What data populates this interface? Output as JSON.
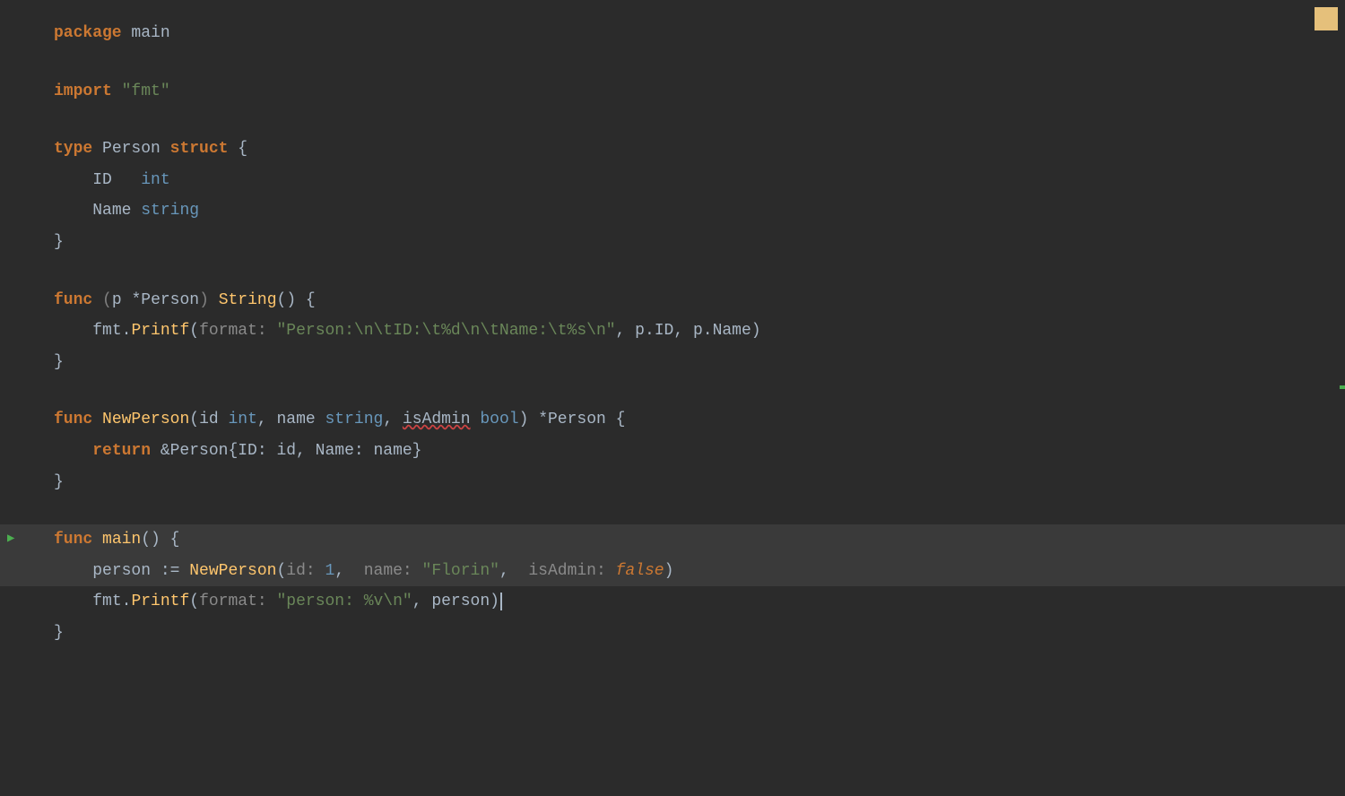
{
  "editor": {
    "background": "#2b2b2b",
    "lines": [
      {
        "id": 1,
        "type": "code",
        "content": "package main"
      },
      {
        "id": 2,
        "type": "empty"
      },
      {
        "id": 3,
        "type": "code",
        "content": "import \"fmt\""
      },
      {
        "id": 4,
        "type": "empty"
      },
      {
        "id": 5,
        "type": "code",
        "content": "type Person struct {"
      },
      {
        "id": 6,
        "type": "code",
        "content": "    ID   int"
      },
      {
        "id": 7,
        "type": "code",
        "content": "    Name string"
      },
      {
        "id": 8,
        "type": "code",
        "content": "}"
      },
      {
        "id": 9,
        "type": "empty"
      },
      {
        "id": 10,
        "type": "code",
        "content": "func (p *Person) String() {"
      },
      {
        "id": 11,
        "type": "code",
        "content": "    fmt.Printf(format: \"Person:\\n\\tID:\\t%d\\n\\tName:\\t%s\\n\", p.ID, p.Name)"
      },
      {
        "id": 12,
        "type": "code",
        "content": "}"
      },
      {
        "id": 13,
        "type": "empty"
      },
      {
        "id": 14,
        "type": "code",
        "content": "func NewPerson(id int, name string, isAdmin bool) *Person {"
      },
      {
        "id": 15,
        "type": "code",
        "content": "    return &Person{ID: id, Name: name}"
      },
      {
        "id": 16,
        "type": "code",
        "content": "}"
      },
      {
        "id": 17,
        "type": "empty"
      },
      {
        "id": 18,
        "type": "code",
        "content": "func main() {",
        "runnable": true,
        "highlighted": true
      },
      {
        "id": 19,
        "type": "code",
        "content": "    person := NewPerson(id: 1,  name: \"Florin\",  isAdmin: false)",
        "highlighted": true
      },
      {
        "id": 20,
        "type": "code",
        "content": "    fmt.Printf(format: \"person: %v\\n\", person)",
        "highlighted": false
      },
      {
        "id": 21,
        "type": "code",
        "content": "}"
      }
    ],
    "corner_indicator_color": "#e5c07b",
    "run_indicator_color": "#4caf50"
  }
}
